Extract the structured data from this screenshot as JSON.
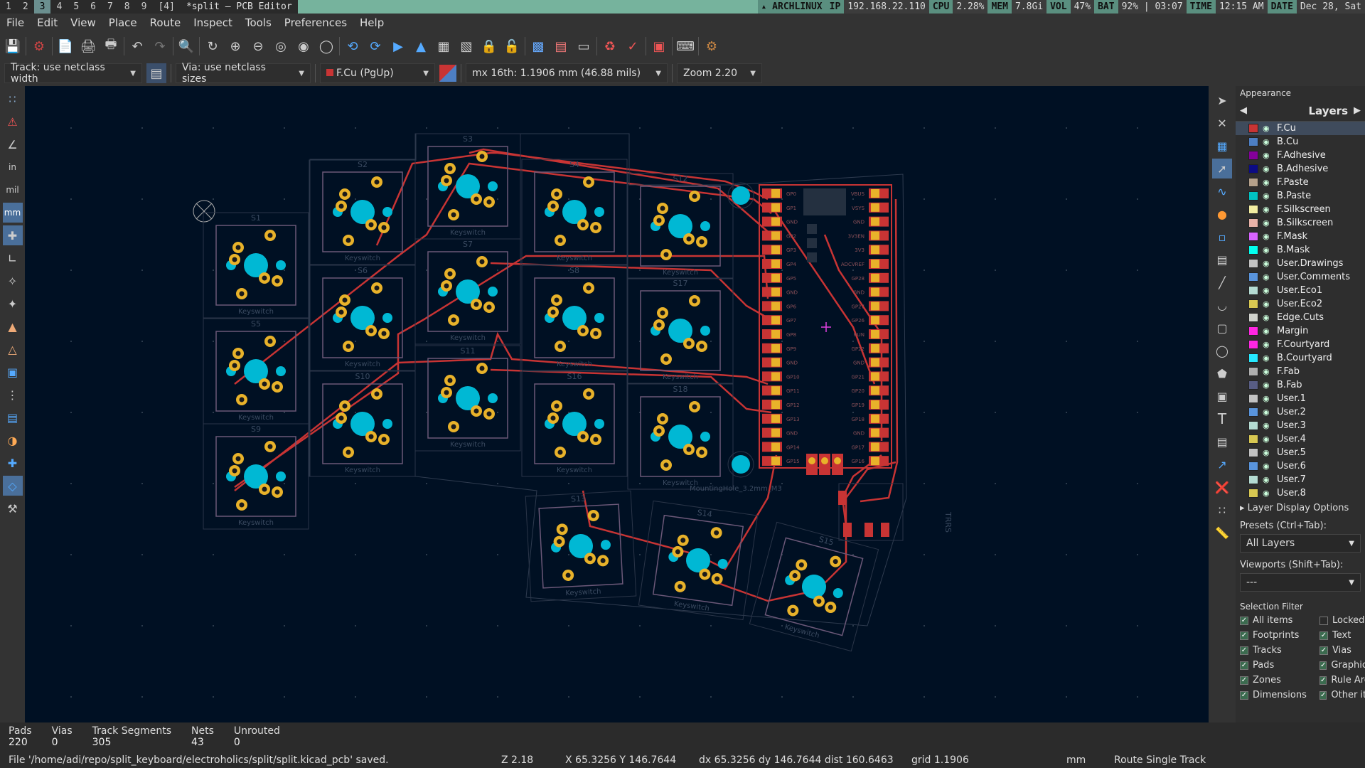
{
  "topbar": {
    "workspaces": [
      "1",
      "2",
      "3",
      "4",
      "5",
      "6",
      "7",
      "8",
      "9",
      "[4]"
    ],
    "window_title": "*split — PCB Editor",
    "os": "▴ ARCHLINUX",
    "ip_k": "IP",
    "ip_v": "192.168.22.110",
    "cpu_k": "CPU",
    "cpu_v": "2.28%",
    "mem_k": "MEM",
    "mem_v": "7.8Gi",
    "vol_k": "VOL",
    "vol_v": "47%",
    "bat_k": "BAT",
    "bat_v": "92% | 03:07",
    "time_k": "TIME",
    "time_v": "12:15 AM",
    "date_k": "DATE",
    "date_v": "Dec 28, Sat"
  },
  "menu": [
    "File",
    "Edit",
    "View",
    "Place",
    "Route",
    "Inspect",
    "Tools",
    "Preferences",
    "Help"
  ],
  "toolbar2": {
    "track": "Track: use netclass width",
    "via": "Via: use netclass sizes",
    "layer": "F.Cu (PgUp)",
    "grid": "mx 16th: 1.1906 mm (46.88 mils)",
    "zoom": "Zoom 2.20"
  },
  "appearance": {
    "title": "Appearance",
    "tab": "Layers",
    "layers": [
      {
        "name": "F.Cu",
        "color": "#c83434"
      },
      {
        "name": "B.Cu",
        "color": "#4d7fc4"
      },
      {
        "name": "F.Adhesive",
        "color": "#84009a"
      },
      {
        "name": "B.Adhesive",
        "color": "#0b0b84"
      },
      {
        "name": "F.Paste",
        "color": "#b4a08a"
      },
      {
        "name": "B.Paste",
        "color": "#00c2c2"
      },
      {
        "name": "F.Silkscreen",
        "color": "#f2eda1"
      },
      {
        "name": "B.Silkscreen",
        "color": "#e8b2a7"
      },
      {
        "name": "F.Mask",
        "color": "#d864ff"
      },
      {
        "name": "B.Mask",
        "color": "#02ffee"
      },
      {
        "name": "User.Drawings",
        "color": "#c2c2c2"
      },
      {
        "name": "User.Comments",
        "color": "#5994dc"
      },
      {
        "name": "User.Eco1",
        "color": "#b4dbd2"
      },
      {
        "name": "User.Eco2",
        "color": "#d8c852"
      },
      {
        "name": "Edge.Cuts",
        "color": "#d0d2cd"
      },
      {
        "name": "Margin",
        "color": "#ff26e2"
      },
      {
        "name": "F.Courtyard",
        "color": "#ff26e2"
      },
      {
        "name": "B.Courtyard",
        "color": "#26e9ff"
      },
      {
        "name": "F.Fab",
        "color": "#afafaf"
      },
      {
        "name": "B.Fab",
        "color": "#585d84"
      },
      {
        "name": "User.1",
        "color": "#c2c2c2"
      },
      {
        "name": "User.2",
        "color": "#5994dc"
      },
      {
        "name": "User.3",
        "color": "#b4dbd2"
      },
      {
        "name": "User.4",
        "color": "#d8c852"
      },
      {
        "name": "User.5",
        "color": "#c2c2c2"
      },
      {
        "name": "User.6",
        "color": "#5994dc"
      },
      {
        "name": "User.7",
        "color": "#b4dbd2"
      },
      {
        "name": "User.8",
        "color": "#d8c852"
      }
    ],
    "layer_display_options": "Layer Display Options",
    "presets_label": "Presets (Ctrl+Tab):",
    "presets_value": "All Layers",
    "viewports_label": "Viewports (Shift+Tab):",
    "viewports_value": "---",
    "selection_filter": "Selection Filter",
    "filters_left": [
      "All items",
      "Footprints",
      "Tracks",
      "Pads",
      "Zones",
      "Dimensions"
    ],
    "filters_right": [
      "Locked",
      "Text",
      "Vias",
      "Graphics",
      "Rule Areas",
      "Other items"
    ]
  },
  "messages": {
    "pads_k": "Pads",
    "pads_v": "220",
    "vias_k": "Vias",
    "vias_v": "0",
    "segs_k": "Track Segments",
    "segs_v": "305",
    "nets_k": "Nets",
    "nets_v": "43",
    "unrouted_k": "Unrouted",
    "unrouted_v": "0"
  },
  "status": {
    "file": "File '/home/adi/repo/split_keyboard/electroholics/split/split.kicad_pcb' saved.",
    "zoom": "Z 2.18",
    "xy": "X 65.3256  Y 146.7644",
    "dxy": "dx 65.3256  dy 146.7644  dist 160.6463",
    "grid": "grid 1.1906",
    "units": "mm",
    "mode": "Route Single Track"
  },
  "pcb": {
    "switches": [
      "S1",
      "S2",
      "S3",
      "S4",
      "S12",
      "S5",
      "S6",
      "S7",
      "S8",
      "S17",
      "S9",
      "S10",
      "S11",
      "S16",
      "S18",
      "S13",
      "S14",
      "S15"
    ],
    "footprint_text": "Keyswitch",
    "mount_hole": "MountingHole_3.2mm_M3",
    "trrs": "TRRS",
    "mcu_left_pins": [
      "GP0",
      "GP1",
      "GND",
      "GP2",
      "GP3",
      "GP4",
      "GP5",
      "GND",
      "GP6",
      "GP7",
      "GP8",
      "GP9",
      "GND",
      "GP10",
      "GP11",
      "GP12",
      "GP13",
      "GND",
      "GP14",
      "GP15"
    ],
    "mcu_right_pins": [
      "VBUS",
      "VSYS",
      "GND",
      "3V3EN",
      "3V3",
      "ADCVREF",
      "GP28",
      "GND",
      "GP27",
      "GP26",
      "RUN",
      "GP22",
      "GND",
      "GP21",
      "GP20",
      "GP19",
      "GP18",
      "GND",
      "GP17",
      "GP16"
    ],
    "colors": {
      "track": "#c83434",
      "pad": "#e8b22a",
      "hole": "#00b8d4",
      "silk": "#3a4a60",
      "bg": "#001023"
    }
  }
}
